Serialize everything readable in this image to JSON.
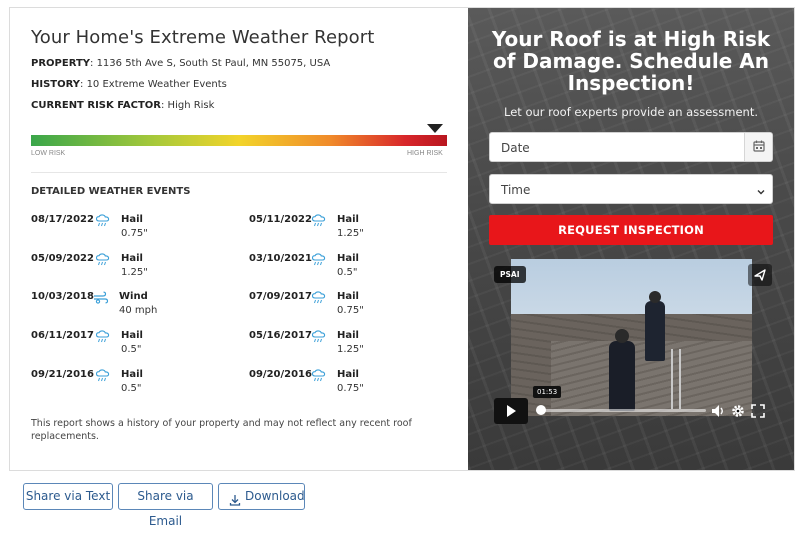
{
  "report": {
    "title": "Your Home's Extreme Weather Report",
    "property_label": "PROPERTY",
    "property_value": ": 1136 5th Ave S, South St Paul, MN 55075, USA",
    "history_label": "HISTORY",
    "history_value": ": 10 Extreme Weather Events",
    "risk_label": "CURRENT RISK FACTOR",
    "risk_value": ": High Risk",
    "risk_scale": {
      "low": "LOW RISK",
      "high": "HIGH RISK",
      "level_fraction": 0.97
    },
    "events_heading": "DETAILED WEATHER EVENTS",
    "events": [
      {
        "date": "08/17/2022",
        "type": "Hail",
        "amount": "0.75\"",
        "icon": "hail-icon"
      },
      {
        "date": "05/11/2022",
        "type": "Hail",
        "amount": "1.25\"",
        "icon": "hail-icon"
      },
      {
        "date": "05/09/2022",
        "type": "Hail",
        "amount": "1.25\"",
        "icon": "hail-icon"
      },
      {
        "date": "03/10/2021",
        "type": "Hail",
        "amount": "0.5\"",
        "icon": "hail-icon"
      },
      {
        "date": "10/03/2018",
        "type": "Wind",
        "amount": "40 mph",
        "icon": "wind-icon"
      },
      {
        "date": "07/09/2017",
        "type": "Hail",
        "amount": "0.75\"",
        "icon": "hail-icon"
      },
      {
        "date": "06/11/2017",
        "type": "Hail",
        "amount": "0.5\"",
        "icon": "hail-icon"
      },
      {
        "date": "05/16/2017",
        "type": "Hail",
        "amount": "1.25\"",
        "icon": "hail-icon"
      },
      {
        "date": "09/21/2016",
        "type": "Hail",
        "amount": "0.5\"",
        "icon": "hail-icon"
      },
      {
        "date": "09/20/2016",
        "type": "Hail",
        "amount": "0.75\"",
        "icon": "hail-icon"
      }
    ],
    "disclaimer": "This report shows a history of your property and may not reflect any recent roof replacements."
  },
  "cta": {
    "title": "Your Roof is at High Risk of Damage. Schedule An Inspection!",
    "subtitle": "Let our roof experts provide an assessment.",
    "date_placeholder": "Date",
    "time_placeholder": "Time",
    "button_label": "REQUEST INSPECTION"
  },
  "video": {
    "chip": "PSAI",
    "time_tooltip": "01:53"
  },
  "share": {
    "text_label": "Share via Text",
    "email_label": "Share via Email",
    "download_label": "Download"
  },
  "colors": {
    "accent_red": "#e8161a",
    "link_blue": "#2c5a8e",
    "icon_blue": "#3a9fd8"
  }
}
